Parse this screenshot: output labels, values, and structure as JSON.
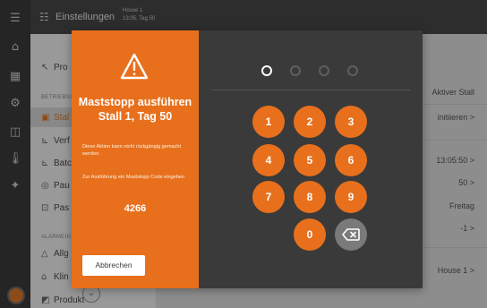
{
  "topbar": {
    "title": "Einstellungen",
    "house": "House 1",
    "datetime": "13:05, Tag 50"
  },
  "sidebar": {
    "items_top": [
      {
        "label": "Pro",
        "icon": "cursor-icon"
      }
    ],
    "section1": "BETRIEBSD",
    "items_section1": [
      {
        "label": "Stal",
        "icon": "grid-icon",
        "active": true
      },
      {
        "label": "Verf",
        "icon": "feed-icon"
      },
      {
        "label": "Batc",
        "icon": "batch-icon"
      },
      {
        "label": "Pau",
        "icon": "pause-icon"
      },
      {
        "label": "Pas",
        "icon": "lock-icon"
      }
    ],
    "section2": "ALARMEIN",
    "items_section2": [
      {
        "label": "Allg",
        "icon": "bell-icon"
      },
      {
        "label": "Klin",
        "icon": "building-icon"
      },
      {
        "label": "Produkt",
        "icon": "chart-icon"
      }
    ]
  },
  "right_pane": {
    "active_stall": "Aktiver Stall",
    "initiate": "initiieren >",
    "time": "13:05:50 >",
    "day": "50 >",
    "weekday": "Freitag",
    "offset": "-1 >",
    "house": "House 1 >"
  },
  "dialog": {
    "title": "Maststopp ausführen Stall 1, Tag 50",
    "warning": "Diese Aktion kann nicht rückgängig gemacht werden.",
    "instruction": "Zur Ausführung ein Maststopp Code eingeben",
    "code": "4266",
    "cancel": "Abbrechen"
  },
  "keypad": {
    "keys": [
      "1",
      "2",
      "3",
      "4",
      "5",
      "6",
      "7",
      "8",
      "9",
      "0"
    ],
    "pin_length": 4,
    "pin_filled": 1
  },
  "colors": {
    "accent": "#e8701c",
    "dialog_dark": "#3a3a3a",
    "rail": "#3d3d3d"
  }
}
